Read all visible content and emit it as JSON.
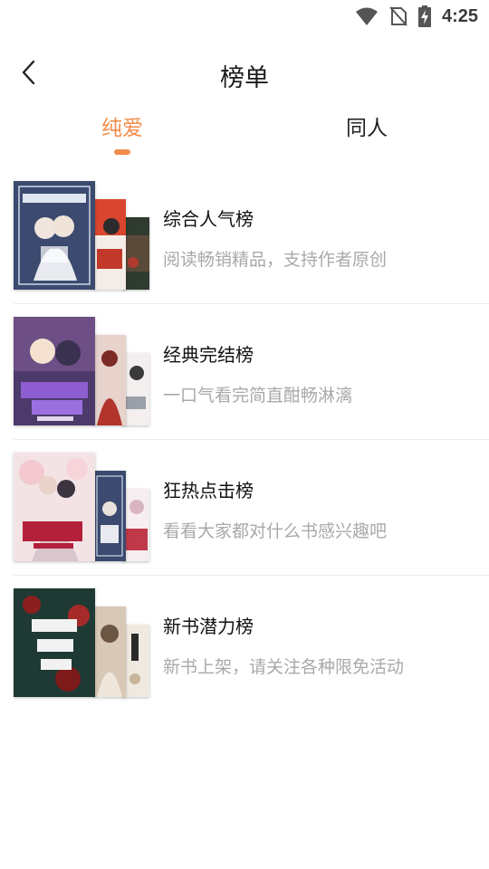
{
  "status_bar": {
    "time": "4:25"
  },
  "header": {
    "title": "榜单"
  },
  "tabs": [
    {
      "label": "纯爱",
      "active": true
    },
    {
      "label": "同人",
      "active": false
    }
  ],
  "colors": {
    "accent": "#f28c4b",
    "desc_text": "#a9a9a9"
  },
  "rank_lists": [
    {
      "name": "综合人气榜",
      "desc": "阅读畅销精品，支持作者原创"
    },
    {
      "name": "经典完结榜",
      "desc": "一口气看完简直酣畅淋漓"
    },
    {
      "name": "狂热点击榜",
      "desc": "看看大家都对什么书感兴趣吧"
    },
    {
      "name": "新书潜力榜",
      "desc": "新书上架，请关注各种限免活动"
    }
  ]
}
